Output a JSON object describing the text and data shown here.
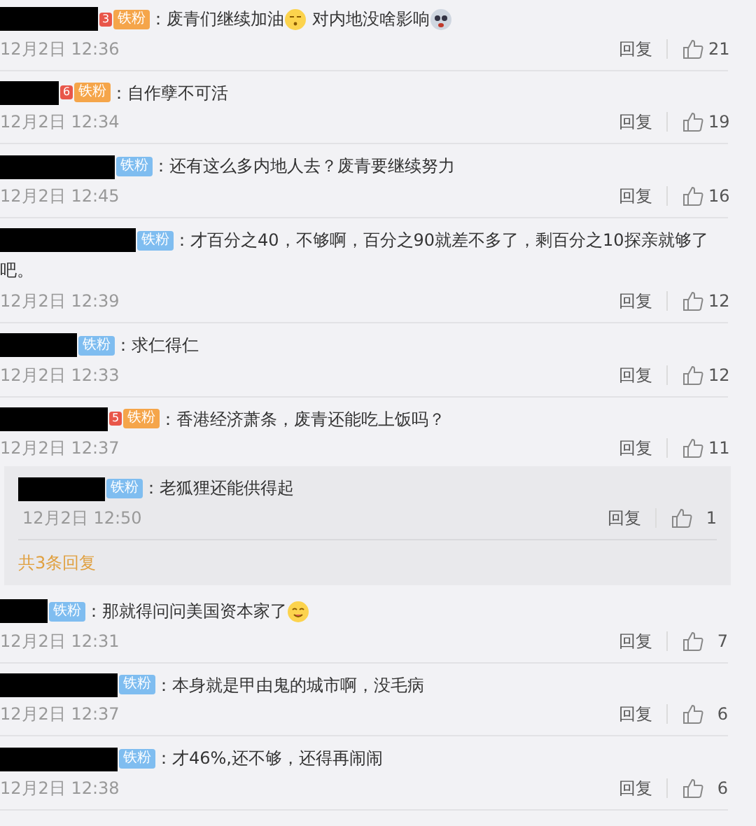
{
  "comments": [
    {
      "badge": {
        "kind": "gold",
        "label": "铁粉",
        "level": "3"
      },
      "segments": [
        {
          "kind": "text",
          "text": "：废青们继续加油"
        },
        {
          "kind": "emoji"
        },
        {
          "kind": "text",
          "text": " 对内地没啥影响"
        },
        {
          "kind": "emoji"
        }
      ],
      "time": "12月2日 12:36",
      "reply_label": "回复",
      "likes": "21"
    },
    {
      "badge": {
        "kind": "gold",
        "label": "铁粉",
        "level": "6"
      },
      "segments": [
        {
          "kind": "text",
          "text": "：自作孽不可活"
        }
      ],
      "time": "12月2日 12:34",
      "reply_label": "回复",
      "likes": "19"
    },
    {
      "badge": {
        "kind": "blue",
        "label": "铁粉"
      },
      "segments": [
        {
          "kind": "text",
          "text": "：还有这么多内地人去？废青要继续努力"
        }
      ],
      "time": "12月2日 12:45",
      "reply_label": "回复",
      "likes": "16"
    },
    {
      "badge": {
        "kind": "blue",
        "label": "铁粉"
      },
      "segments": [
        {
          "kind": "text",
          "text": "：才百分之40，不够啊，百分之90就差不多了，剩百分之10探亲就够了"
        },
        {
          "kind": "continued",
          "text": "吧。"
        }
      ],
      "time": "12月2日 12:39",
      "reply_label": "回复",
      "likes": "12"
    },
    {
      "badge": {
        "kind": "blue",
        "label": "铁粉"
      },
      "segments": [
        {
          "kind": "text",
          "text": "：求仁得仁"
        }
      ],
      "time": "12月2日 12:33",
      "reply_label": "回复",
      "likes": "12"
    },
    {
      "badge": {
        "kind": "gold",
        "label": "铁粉",
        "level": "5"
      },
      "segments": [
        {
          "kind": "text",
          "text": "：香港经济萧条，废青还能吃上饭吗？"
        }
      ],
      "time": "12月2日 12:37",
      "reply_label": "回复",
      "likes": "11",
      "replies": {
        "items": [
          {
            "badge": {
              "kind": "blue",
              "label": "铁粉"
            },
            "segments": [
              {
                "kind": "text",
                "text": "：老狐狸还能供得起"
              }
            ],
            "time": "12月2日 12:50",
            "reply_label": "回复",
            "likes": "1"
          }
        ],
        "more": "共3条回复"
      }
    },
    {
      "badge": {
        "kind": "blue",
        "label": "铁粉"
      },
      "segments": [
        {
          "kind": "text",
          "text": "：那就得问问美国资本家了"
        },
        {
          "kind": "emoji"
        }
      ],
      "time": "12月2日 12:31",
      "reply_label": "回复",
      "likes": "7"
    },
    {
      "badge": {
        "kind": "blue",
        "label": "铁粉"
      },
      "segments": [
        {
          "kind": "text",
          "text": "：本身就是甲由鬼的城市啊，没毛病"
        }
      ],
      "time": "12月2日 12:37",
      "reply_label": "回复",
      "likes": "6"
    },
    {
      "badge": {
        "kind": "blue",
        "label": "铁粉"
      },
      "segments": [
        {
          "kind": "text",
          "text": "：才46%,还不够，还得再闹闹"
        }
      ],
      "time": "12月2日 12:38",
      "reply_label": "回复",
      "likes": "6"
    }
  ]
}
